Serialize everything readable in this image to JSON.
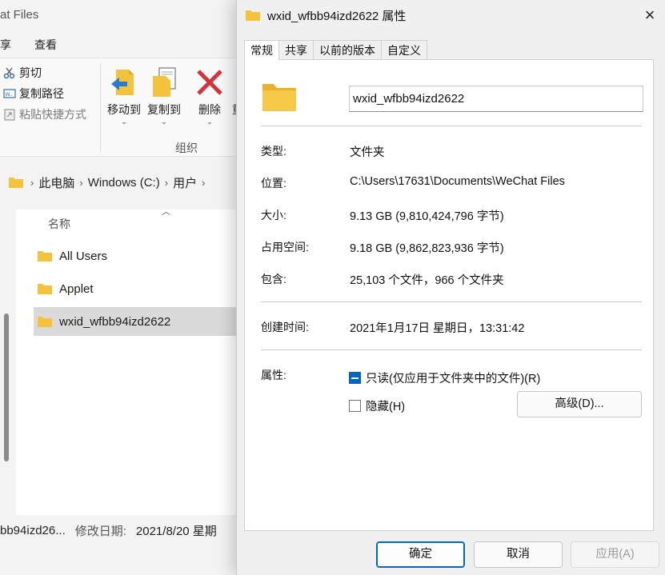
{
  "explorer": {
    "title_partial": "at Files",
    "menu": {
      "share_partial": "享",
      "view": "查看"
    },
    "ribbon": {
      "cut": "剪切",
      "copy_path": "复制路径",
      "paste_shortcut": "粘贴快捷方式",
      "move_to": "移动到",
      "copy_to": "复制到",
      "delete": "删除",
      "rename_partial": "重",
      "group_label": "组织"
    },
    "breadcrumb": [
      "此电脑",
      "Windows (C:)",
      "用户"
    ],
    "column_name": "名称",
    "files": [
      "All Users",
      "Applet",
      "wxid_wfbb94izd2622"
    ],
    "status": {
      "name_partial": "bb94izd26...",
      "modified_label": "修改日期:",
      "modified_value": "2021/8/20 星期"
    }
  },
  "dialog": {
    "title": "wxid_wfbb94izd2622 属性",
    "close": "×",
    "tabs": [
      "常规",
      "共享",
      "以前的版本",
      "自定义"
    ],
    "name_value": "wxid_wfbb94izd2622",
    "props": {
      "type_label": "类型:",
      "type_value": "文件夹",
      "location_label": "位置:",
      "location_value": "C:\\Users\\17631\\Documents\\WeChat Files",
      "size_label": "大小:",
      "size_value": "9.13 GB (9,810,424,796 字节)",
      "disk_label": "占用空间:",
      "disk_value": "9.18 GB (9,862,823,936 字节)",
      "contains_label": "包含:",
      "contains_value": "25,103 个文件，966 个文件夹",
      "created_label": "创建时间:",
      "created_value": "2021年1月17日 星期日，13:31:42",
      "attributes_label": "属性:",
      "readonly_label": "只读(仅应用于文件夹中的文件)(R)",
      "hidden_label": "隐藏(H)",
      "advanced_button": "高级(D)..."
    },
    "buttons": {
      "ok": "确定",
      "cancel": "取消",
      "apply": "应用(A)"
    }
  },
  "colors": {
    "accent": "#0067c0",
    "folder": "#f5c33b",
    "delete_red": "#d13438"
  }
}
